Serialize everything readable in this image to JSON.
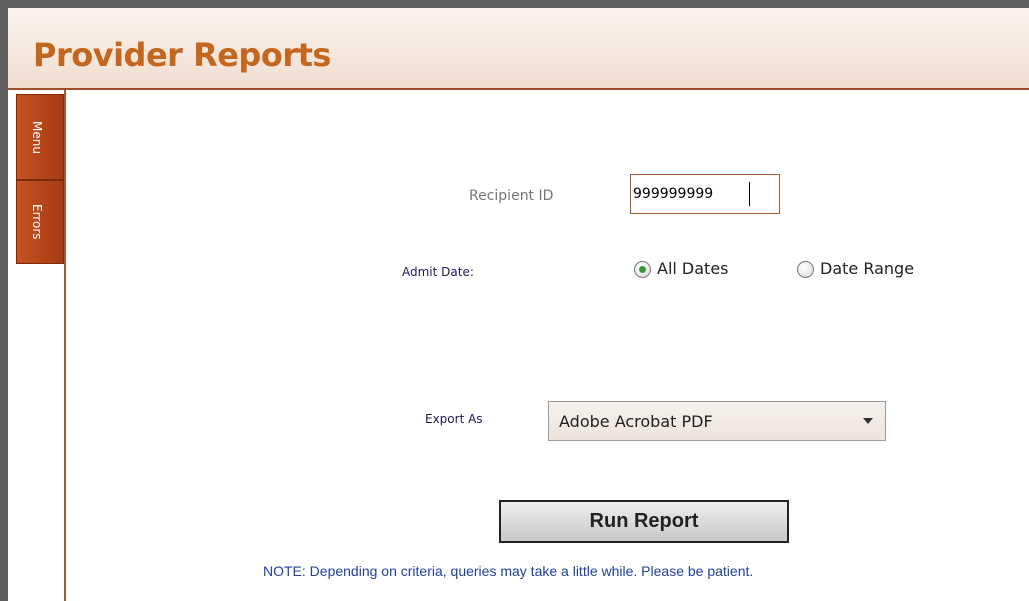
{
  "header": {
    "title": "Provider Reports"
  },
  "sidebar": {
    "tabs": [
      {
        "label": "Menu"
      },
      {
        "label": "Errors"
      }
    ]
  },
  "form": {
    "recipient_label": "Recipient ID",
    "recipient_value": "999999999",
    "admit_label": "Admit Date:",
    "admit_options": [
      {
        "label": "All Dates",
        "selected": true
      },
      {
        "label": "Date Range",
        "selected": false
      }
    ],
    "export_label": "Export As",
    "export_value": "Adobe Acrobat PDF",
    "run_label": "Run Report",
    "note": "NOTE: Depending on criteria, queries may take a little while. Please be patient."
  },
  "colors": {
    "accent": "#c5661e",
    "tab": "#b84818",
    "border": "#9a4f2d",
    "note": "#1f3fa0"
  }
}
